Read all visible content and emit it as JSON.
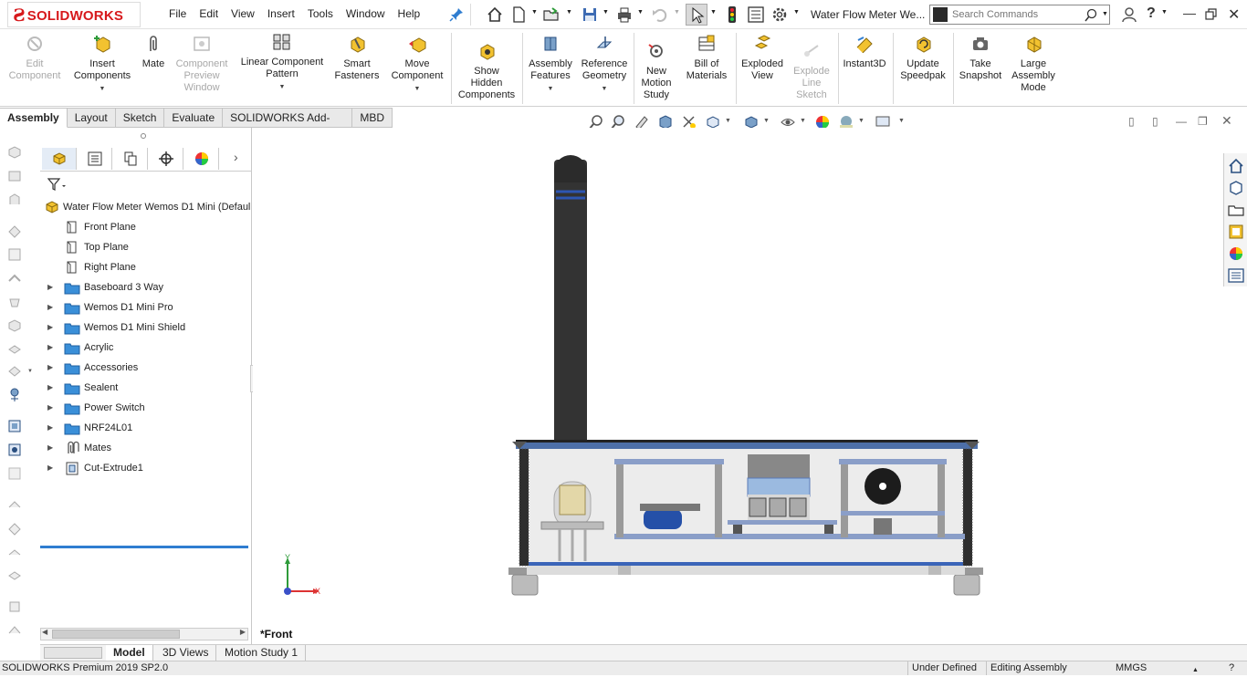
{
  "app": {
    "logo_text": "SOLIDWORKS",
    "document_title": "Water Flow Meter We...",
    "search_placeholder": "Search Commands"
  },
  "menu": [
    "File",
    "Edit",
    "View",
    "Insert",
    "Tools",
    "Window",
    "Help"
  ],
  "commands": [
    {
      "label_lines": [
        "Edit",
        "Component"
      ],
      "disabled": true
    },
    {
      "label_lines": [
        "Insert",
        "Components"
      ],
      "disabled": false,
      "dropdown": true
    },
    {
      "label_lines": [
        "Mate"
      ],
      "disabled": false
    },
    {
      "label_lines": [
        "Component",
        "Preview",
        "Window"
      ],
      "disabled": true
    },
    {
      "label_lines": [
        "Linear Component",
        "Pattern"
      ],
      "disabled": false,
      "dropdown": true
    },
    {
      "label_lines": [
        "Smart",
        "Fasteners"
      ],
      "disabled": false
    },
    {
      "label_lines": [
        "Move",
        "Component"
      ],
      "disabled": false,
      "dropdown": true
    },
    {
      "label_lines": [
        "Show",
        "Hidden",
        "Components"
      ],
      "disabled": false
    },
    {
      "label_lines": [
        "Assembly",
        "Features"
      ],
      "disabled": false,
      "dropdown": true
    },
    {
      "label_lines": [
        "Reference",
        "Geometry"
      ],
      "disabled": false,
      "dropdown": true
    },
    {
      "label_lines": [
        "New",
        "Motion",
        "Study"
      ],
      "disabled": false
    },
    {
      "label_lines": [
        "Bill of",
        "Materials"
      ],
      "disabled": false
    },
    {
      "label_lines": [
        "Exploded",
        "View"
      ],
      "disabled": false
    },
    {
      "label_lines": [
        "Explode",
        "Line",
        "Sketch"
      ],
      "disabled": true
    },
    {
      "label_lines": [
        "Instant3D"
      ],
      "disabled": false
    },
    {
      "label_lines": [
        "Update",
        "Speedpak"
      ],
      "disabled": false
    },
    {
      "label_lines": [
        "Take",
        "Snapshot"
      ],
      "disabled": false
    },
    {
      "label_lines": [
        "Large",
        "Assembly",
        "Mode"
      ],
      "disabled": false
    }
  ],
  "tabs": [
    "Assembly",
    "Layout",
    "Sketch",
    "Evaluate",
    "SOLIDWORKS Add-Ins",
    "MBD"
  ],
  "tree": {
    "root": "Water Flow Meter Wemos D1 Mini  (Defaul",
    "items": [
      {
        "label": "Front Plane",
        "icon": "plane-icon",
        "expandable": false
      },
      {
        "label": "Top Plane",
        "icon": "plane-icon",
        "expandable": false
      },
      {
        "label": "Right Plane",
        "icon": "plane-icon",
        "expandable": false
      },
      {
        "label": "Baseboard 3 Way",
        "icon": "folder-icon",
        "expandable": true
      },
      {
        "label": "Wemos D1 Mini Pro",
        "icon": "folder-icon",
        "expandable": true
      },
      {
        "label": "Wemos D1 Mini Shield",
        "icon": "folder-icon",
        "expandable": true
      },
      {
        "label": "Acrylic",
        "icon": "folder-icon",
        "expandable": true
      },
      {
        "label": "Accessories",
        "icon": "folder-icon",
        "expandable": true
      },
      {
        "label": "Sealent",
        "icon": "folder-icon",
        "expandable": true
      },
      {
        "label": "Power Switch",
        "icon": "folder-icon",
        "expandable": true
      },
      {
        "label": "NRF24L01",
        "icon": "folder-icon",
        "expandable": true
      },
      {
        "label": "Mates",
        "icon": "mates-icon",
        "expandable": true
      },
      {
        "label": "Cut-Extrude1",
        "icon": "cut-extrude-icon",
        "expandable": true
      }
    ]
  },
  "graphics": {
    "view_name": "*Front",
    "axis_y": "Y",
    "axis_x": "X"
  },
  "bottom_tabs": [
    "Model",
    "3D Views",
    "Motion Study 1"
  ],
  "status": {
    "product": "SOLIDWORKS Premium 2019 SP2.0",
    "definition": "Under Defined",
    "mode": "Editing Assembly",
    "units": "MMGS"
  },
  "colors": {
    "accent_blue": "#2f7dd0",
    "logo_red": "#d7191c",
    "folder_blue": "#3a8fd8"
  }
}
